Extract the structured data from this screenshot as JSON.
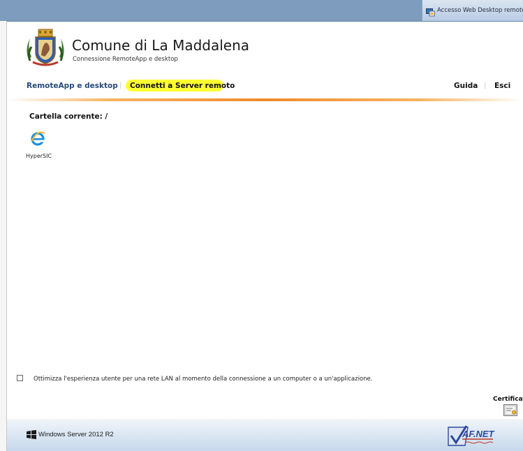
{
  "topband": {
    "window_title": "Accesso Web Desktop remoto"
  },
  "header": {
    "org_title": "Comune di La Maddalena",
    "org_subtitle": "Connessione RemoteApp e desktop"
  },
  "nav": {
    "tab_remoteapp": "RemoteApp e desktop",
    "tab_connect": "Connetti a Server remoto",
    "help": "Guida",
    "exit": "Esci"
  },
  "main": {
    "current_folder": "Cartella corrente: /",
    "apps": [
      {
        "label": "HyperSIC",
        "icon": "internet-explorer-icon"
      }
    ],
    "lan_option": {
      "checked": false,
      "label": "Ottimizza l'esperienza utente per una rete LAN al momento della connessione a un computer o a un'applicazione."
    },
    "certificate_label": "Certificato"
  },
  "footer": {
    "os_label": "Windows Server 2012 R2",
    "partner_logo": "AF.NET"
  },
  "colors": {
    "nav_link": "#274a78",
    "highlight": "#ffff33",
    "accent_rule": "#f08a2c",
    "topband": "#7d9cbe"
  }
}
